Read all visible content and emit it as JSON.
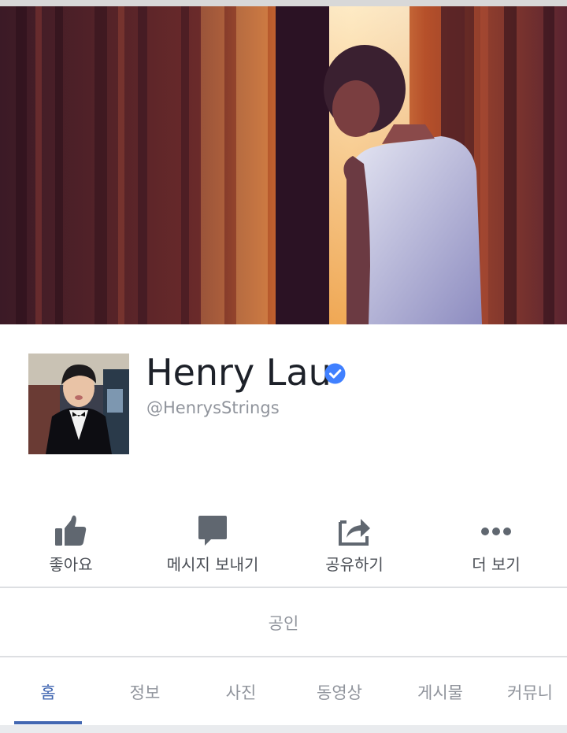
{
  "page": {
    "name": "Henry Lau",
    "handle": "@HenrysStrings",
    "category": "공인",
    "verified": true
  },
  "actions": [
    {
      "label": "좋아요",
      "icon": "thumbs-up-icon"
    },
    {
      "label": "메시지 보내기",
      "icon": "message-icon"
    },
    {
      "label": "공유하기",
      "icon": "share-icon"
    },
    {
      "label": "더 보기",
      "icon": "more-icon"
    }
  ],
  "tabs": [
    {
      "label": "홈",
      "active": true
    },
    {
      "label": "정보",
      "active": false
    },
    {
      "label": "사진",
      "active": false
    },
    {
      "label": "동영상",
      "active": false
    },
    {
      "label": "게시물",
      "active": false
    },
    {
      "label": "커뮤니",
      "active": false
    }
  ],
  "colors": {
    "accent": "#4267b2",
    "verified_badge": "#4080ff",
    "icon_gray": "#606770",
    "text_secondary": "#90949c"
  }
}
